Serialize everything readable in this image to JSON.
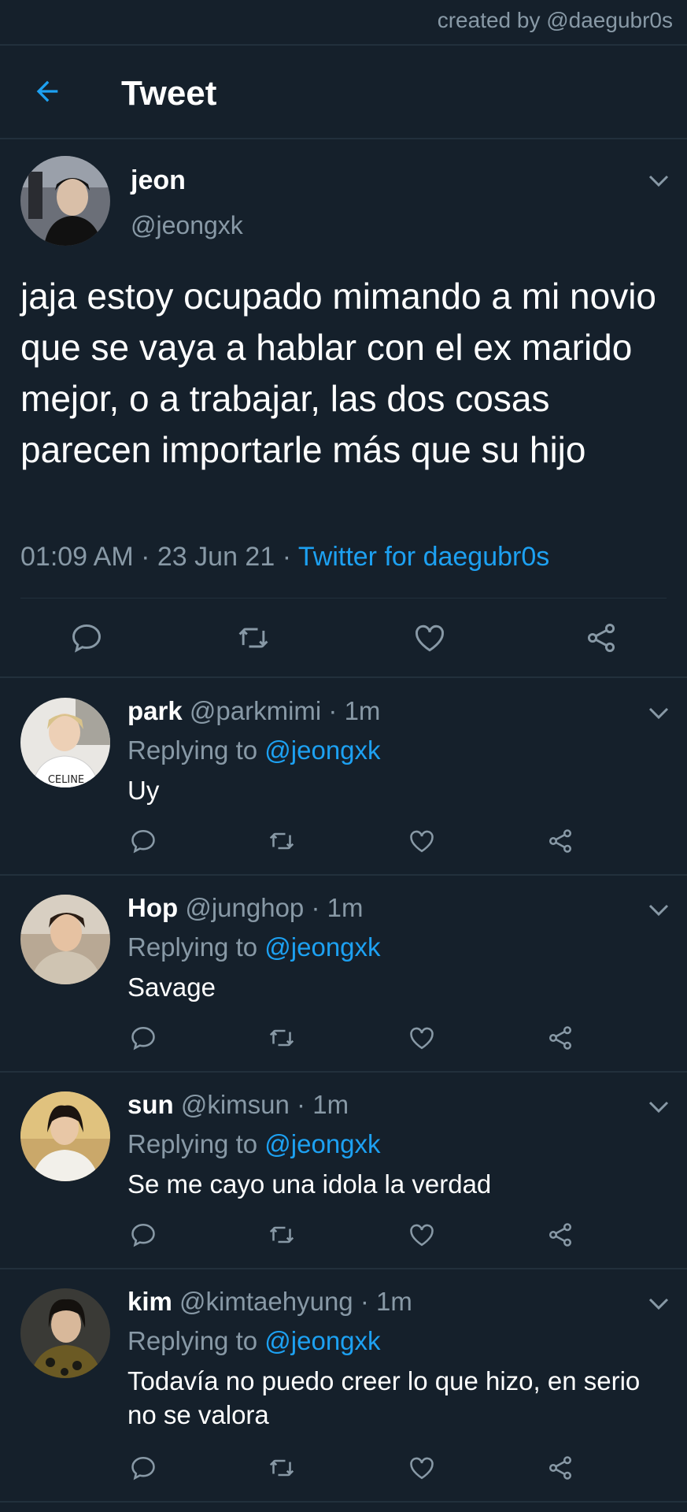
{
  "watermark": "created by @daegubr0s",
  "header": {
    "title": "Tweet"
  },
  "tweet": {
    "name": "jeon",
    "handle": "@jeongxk",
    "text": "jaja estoy ocupado mimando a mi novio que se vaya a hablar con el ex marido mejor, o a trabajar, las dos cosas parecen importarle más que su hijo",
    "time": "01:09 AM",
    "date": "23 Jun 21",
    "via": "Twitter for daegubr0s",
    "separator": "·"
  },
  "replies": [
    {
      "name": "park",
      "handle": "@parkmimi",
      "time": "1m",
      "replying_label": "Replying to",
      "mention": "@jeongxk",
      "text": "Uy",
      "avatar_text": "CELINE"
    },
    {
      "name": "Hop",
      "handle": "@junghop",
      "time": "1m",
      "replying_label": "Replying to",
      "mention": "@jeongxk",
      "text": "Savage"
    },
    {
      "name": "sun",
      "handle": "@kimsun",
      "time": "1m",
      "replying_label": "Replying to",
      "mention": "@jeongxk",
      "text": "Se me cayo una idola la verdad"
    },
    {
      "name": "kim",
      "handle": "@kimtaehyung",
      "time": "1m",
      "replying_label": "Replying to",
      "mention": "@jeongxk",
      "text": "Todavía no puedo creer lo que hizo, en serio no se valora"
    }
  ],
  "colors": {
    "background": "#15202b",
    "accent": "#1da1f2",
    "muted": "#8899a6",
    "divider": "#22303c"
  },
  "icons": [
    "back-arrow-icon",
    "chevron-down-icon",
    "reply-icon",
    "retweet-icon",
    "like-icon",
    "share-icon"
  ]
}
